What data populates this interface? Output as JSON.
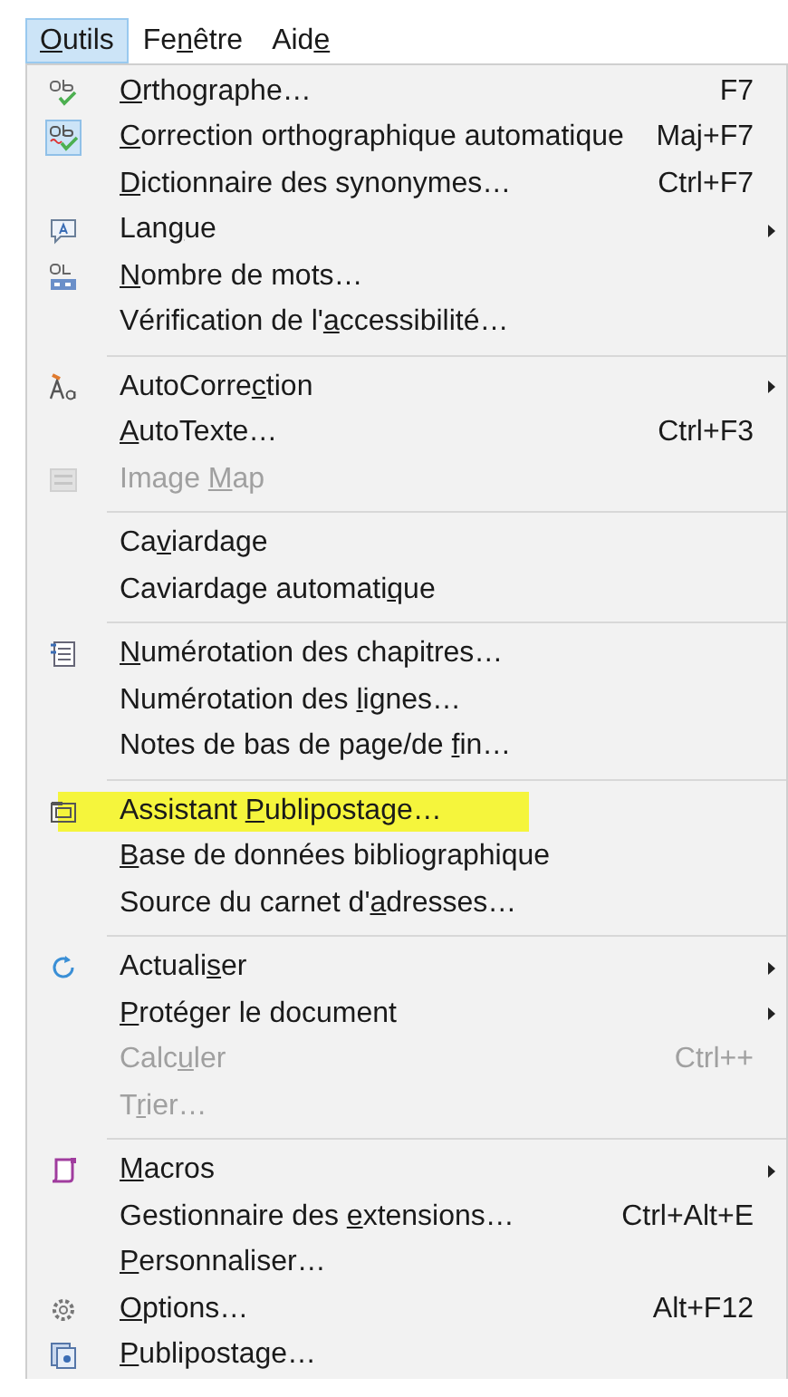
{
  "menubar": [
    {
      "key": "O",
      "after": "utils",
      "selected": true
    },
    {
      "before": "Fe",
      "key": "n",
      "after": "être",
      "selected": false
    },
    {
      "before": "Aid",
      "key": "e",
      "selected": false
    }
  ],
  "menu": [
    {
      "kind": "item",
      "key": "O",
      "after": "rthographe…",
      "shortcut": "F7",
      "checked": false,
      "disabled": false,
      "highlighted": false,
      "submenu": false
    },
    {
      "kind": "item",
      "key": "C",
      "after": "orrection orthographique automatique",
      "shortcut": "Maj+F7",
      "checked": true,
      "disabled": false,
      "highlighted": false,
      "submenu": false
    },
    {
      "kind": "item",
      "key": "D",
      "after": "ictionnaire des synonymes…",
      "shortcut": "Ctrl+F7",
      "checked": false,
      "disabled": false,
      "highlighted": false,
      "submenu": false
    },
    {
      "kind": "item",
      "before": "Lan",
      "key": "g",
      "after": "ue",
      "checked": false,
      "disabled": false,
      "highlighted": false,
      "submenu": true
    },
    {
      "kind": "item",
      "key": "N",
      "after": "ombre de mots…",
      "checked": false,
      "disabled": false,
      "highlighted": false,
      "submenu": false
    },
    {
      "kind": "item",
      "before": "Vérification de l'",
      "key": "a",
      "after": "ccessibilité…",
      "checked": false,
      "disabled": false,
      "highlighted": false,
      "submenu": false
    },
    {
      "kind": "separator"
    },
    {
      "kind": "item",
      "before": "AutoCorre",
      "key": "c",
      "after": "tion",
      "checked": false,
      "disabled": false,
      "highlighted": false,
      "submenu": true
    },
    {
      "kind": "item",
      "key": "A",
      "after": "utoTexte…",
      "shortcut": "Ctrl+F3",
      "checked": false,
      "disabled": false,
      "highlighted": false,
      "submenu": false
    },
    {
      "kind": "item",
      "before": "Image ",
      "key": "M",
      "after": "ap",
      "checked": false,
      "disabled": true,
      "highlighted": false,
      "submenu": false
    },
    {
      "kind": "separator"
    },
    {
      "kind": "item",
      "before": "Ca",
      "key": "v",
      "after": "iardage",
      "checked": false,
      "disabled": false,
      "highlighted": false,
      "submenu": false
    },
    {
      "kind": "item",
      "before": "Caviardage automati",
      "key": "q",
      "after": "ue",
      "checked": false,
      "disabled": false,
      "highlighted": false,
      "submenu": false
    },
    {
      "kind": "separator"
    },
    {
      "kind": "item",
      "key": "N",
      "after": "umérotation des chapitres…",
      "checked": false,
      "disabled": false,
      "highlighted": false,
      "submenu": false
    },
    {
      "kind": "item",
      "before": "Numérotation des ",
      "key": "l",
      "after": "ignes…",
      "checked": false,
      "disabled": false,
      "highlighted": false,
      "submenu": false
    },
    {
      "kind": "item",
      "before": "Notes de bas de page/de ",
      "key": "f",
      "after": "in…",
      "checked": false,
      "disabled": false,
      "highlighted": false,
      "submenu": false
    },
    {
      "kind": "separator"
    },
    {
      "kind": "item",
      "before": "Assistant ",
      "key": "P",
      "after": "ublipostage…",
      "checked": false,
      "disabled": false,
      "highlighted": true,
      "submenu": false
    },
    {
      "kind": "item",
      "key": "B",
      "after": "ase de données bibliographique",
      "checked": false,
      "disabled": false,
      "highlighted": false,
      "submenu": false
    },
    {
      "kind": "item",
      "before": "Source du carnet d'",
      "key": "a",
      "after": "dresses…",
      "checked": false,
      "disabled": false,
      "highlighted": false,
      "submenu": false
    },
    {
      "kind": "separator"
    },
    {
      "kind": "item",
      "before": "Actuali",
      "key": "s",
      "after": "er",
      "checked": false,
      "disabled": false,
      "highlighted": false,
      "submenu": true
    },
    {
      "kind": "item",
      "key": "P",
      "after": "rotéger le document",
      "checked": false,
      "disabled": false,
      "highlighted": false,
      "submenu": true
    },
    {
      "kind": "item",
      "before": "Calc",
      "key": "u",
      "after": "ler",
      "shortcut": "Ctrl++",
      "checked": false,
      "disabled": true,
      "highlighted": false,
      "submenu": false
    },
    {
      "kind": "item",
      "before": "T",
      "key": "r",
      "after": "ier…",
      "checked": false,
      "disabled": true,
      "highlighted": false,
      "submenu": false
    },
    {
      "kind": "separator"
    },
    {
      "kind": "item",
      "key": "M",
      "after": "acros",
      "checked": false,
      "disabled": false,
      "highlighted": false,
      "submenu": true
    },
    {
      "kind": "item",
      "before": "Gestionnaire des ",
      "key": "e",
      "after": "xtensions…",
      "shortcut": "Ctrl+Alt+E",
      "checked": false,
      "disabled": false,
      "highlighted": false,
      "submenu": false
    },
    {
      "kind": "item",
      "key": "P",
      "after": "ersonnaliser…",
      "checked": false,
      "disabled": false,
      "highlighted": false,
      "submenu": false
    },
    {
      "kind": "item",
      "key": "O",
      "after": "ptions…",
      "shortcut": "Alt+F12",
      "checked": false,
      "disabled": false,
      "highlighted": false,
      "submenu": false
    },
    {
      "kind": "item",
      "key": "P",
      "after": "ublipostage…",
      "checked": false,
      "disabled": false,
      "highlighted": false,
      "submenu": false
    }
  ]
}
